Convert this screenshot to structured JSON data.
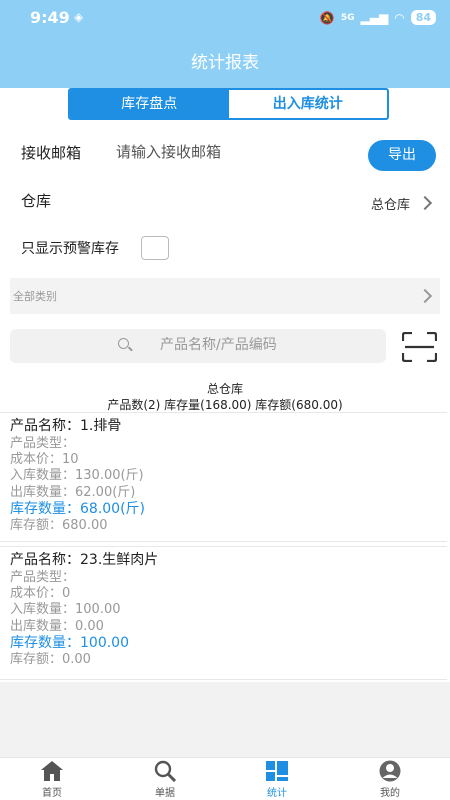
{
  "status": {
    "time": "9:49",
    "battery": "84",
    "network": "5G"
  },
  "header": {
    "title": "统计报表"
  },
  "tabs": [
    {
      "label": "库存盘点",
      "active": true
    },
    {
      "label": "出入库统计",
      "active": false
    }
  ],
  "email": {
    "label": "接收邮箱",
    "placeholder": "请输入接收邮箱",
    "value": "",
    "export_label": "导出"
  },
  "warehouse": {
    "label": "仓库",
    "value": "总仓库"
  },
  "warning_filter": {
    "label": "只显示预警库存",
    "checked": false
  },
  "category": {
    "label": "全部类别"
  },
  "search": {
    "placeholder": "产品名称/产品编码"
  },
  "summary": {
    "title": "总仓库",
    "detail": "产品数(2) 库存量(168.00) 库存额(680.00)"
  },
  "products": [
    {
      "name": "产品名称：1.排骨",
      "type": "产品类型：",
      "cost": "成本价：10",
      "in_qty": "入库数量：130.00(斤)",
      "out_qty": "出库数量：62.00(斤)",
      "stock_qty": "库存数量：68.00(斤)",
      "stock_amount": "库存额：680.00"
    },
    {
      "name": "产品名称：23.生鲜肉片",
      "type": "产品类型：",
      "cost": "成本价：0",
      "in_qty": "入库数量：100.00",
      "out_qty": "出库数量：0.00",
      "stock_qty": "库存数量：100.00",
      "stock_amount": "库存额：0.00"
    }
  ],
  "nav": [
    {
      "label": "首页",
      "icon": "home-icon"
    },
    {
      "label": "单据",
      "icon": "search-icon"
    },
    {
      "label": "统计",
      "icon": "grid-stats-icon",
      "active": true
    },
    {
      "label": "我的",
      "icon": "user-icon"
    }
  ],
  "colors": {
    "header": "#8ecff5",
    "accent": "#1e8fe3"
  }
}
